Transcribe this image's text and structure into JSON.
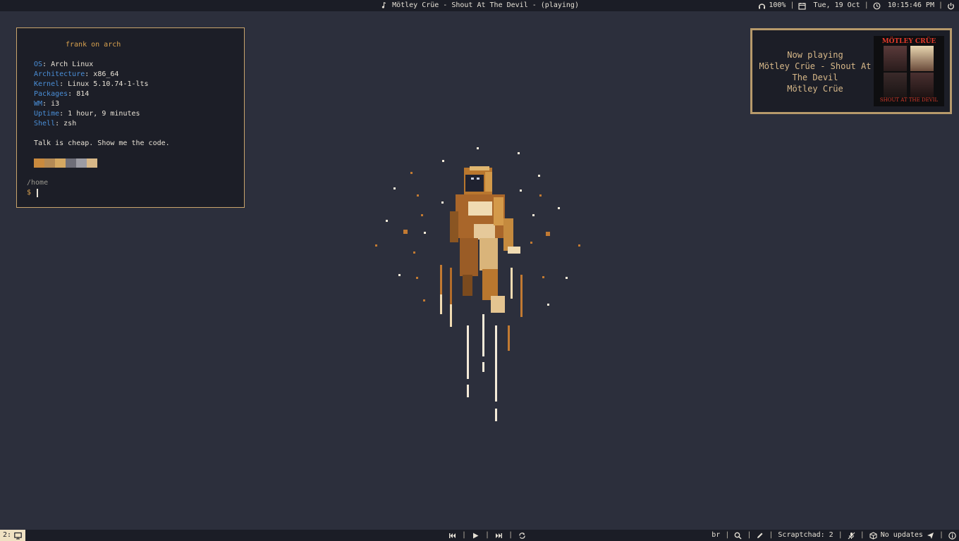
{
  "topbar": {
    "now_playing": "Mötley Crüe - Shout At The Devil - (playing)",
    "volume": "100%",
    "date": "Tue, 19 Oct",
    "time": "10:15:46 PM",
    "icons": [
      "music-note-icon",
      "headphones-icon",
      "calendar-icon",
      "clock-icon",
      "power-icon"
    ]
  },
  "terminal": {
    "title": "frank on arch",
    "info": [
      {
        "key": "OS",
        "value": "Arch Linux"
      },
      {
        "key": "Architecture",
        "value": "x86_64"
      },
      {
        "key": "Kernel",
        "value": "Linux 5.10.74-1-lts"
      },
      {
        "key": "Packages",
        "value": "814"
      },
      {
        "key": "WM",
        "value": "i3"
      },
      {
        "key": "Uptime",
        "value": "1 hour, 9 minutes"
      },
      {
        "key": "Shell",
        "value": "zsh"
      }
    ],
    "quote": "Talk is cheap. Show me the code.",
    "palette": [
      "#c98a3e",
      "#b48a55",
      "#d4a862",
      "#6e6e78",
      "#9c9ca4",
      "#d8b888"
    ],
    "cwd": "/home",
    "prompt": "$"
  },
  "now_playing": {
    "line1": "Now playing",
    "line2": "Mötley Crüe - Shout At",
    "line3": "The Devil",
    "line4": "Mötley Crüe",
    "cover_logo": "MÖTLEY CRÜE",
    "cover_caption": "SHOUT AT THE DEVIL"
  },
  "bottombar": {
    "workspace": "2:",
    "layout": "br",
    "scratchpad": "Scraptchad: 2",
    "updates": "No updates",
    "icons": [
      "monitor-icon",
      "previous-icon",
      "play-icon",
      "next-icon",
      "repeat-icon",
      "search-icon",
      "pen-icon",
      "mic-icon",
      "package-icon",
      "send-icon",
      "info-icon"
    ]
  },
  "colors": {
    "background": "#2c2f3c",
    "bar": "#1b1d26",
    "accent": "#d9a24f",
    "key_blue": "#4a8fd8"
  }
}
